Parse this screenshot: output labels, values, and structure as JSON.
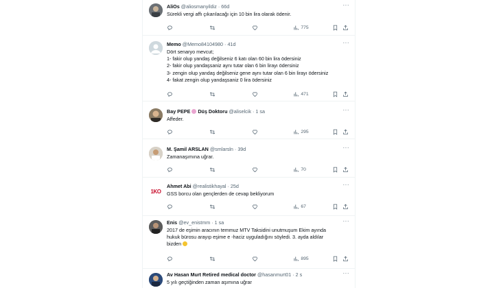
{
  "tweets": [
    {
      "name": "AliOs",
      "handle": "@aliosmanyildiz",
      "sep": "·",
      "time": "66d",
      "text": "Sürekli vergi affı çıkarılacağı için 10 bin lira olarak ödenir.",
      "views": "775",
      "replies": "",
      "retweets": "",
      "likes": ""
    },
    {
      "name": "Memo",
      "handle": "@Memo84104980",
      "sep": "·",
      "time": "41d",
      "text": "Dört senaryo mevcut;\n1- fakir olup yandaş değilseniz 6 katı olan 60 bin lira ödersiniz\n2- fakir olup yandaşsaniz aynı tutar olan 6 bin lirayı ödersiniz\n3- zengin olup yandaş değilseniz gene aynı tutar olan 6 bin lirayı ödersiniz\n4- fakat zengin olup  yandaşsaniz 0 lira ödersiniz",
      "views": "471",
      "replies": "",
      "retweets": "",
      "likes": ""
    },
    {
      "name": "Bay PEPE",
      "name2": "Düş Doktoru",
      "handle": "@aliselcik",
      "sep": "·",
      "time": "1 sa",
      "text": "Affeder.",
      "views": "295",
      "replies": "",
      "retweets": "",
      "likes": ""
    },
    {
      "name": "M. Şamil ARSLAN",
      "handle": "@smlarsln",
      "sep": "·",
      "time": "39d",
      "text": "Zamanaşımına uğrar.",
      "views": "70",
      "replies": "",
      "retweets": "",
      "likes": ""
    },
    {
      "name": "Ahmet Abi",
      "handle": "@realistikhayal",
      "sep": "·",
      "time": "25d",
      "text": "GSS borcu olan gençlerden de cevap bekliyorum",
      "views": "67",
      "replies": "",
      "retweets": "",
      "likes": ""
    },
    {
      "name": "Enis",
      "handle": "@ev_enistmm",
      "sep": "·",
      "time": "1 sa",
      "text": "2017 de eşimin aracının temmuz MTV Taksidini unutmuşum Ekim ayında\nhukuk bürosu arayıp eşime e -haciz uyguladığını söyledi. 3. ayda aldılar\nbizden",
      "views": "895",
      "replies": "",
      "retweets": "",
      "likes": ""
    },
    {
      "name": "Av Hasan Murt Retired medical doctor",
      "handle": "@hasanmurt01",
      "sep": "·",
      "time": "2 s",
      "text": "5 yılı geçtiğinden zaman aşımına uğrar",
      "views": "",
      "replies": "",
      "retweets": "",
      "likes": ""
    }
  ],
  "icons": {
    "more": "more-horizontal-icon",
    "reply": "reply-icon",
    "retweet": "retweet-icon",
    "like": "heart-icon",
    "views": "analytics-icon",
    "bookmark": "bookmark-icon",
    "share": "share-icon"
  },
  "avatar_letters": {
    "ahmet": "1KO"
  },
  "colors": {
    "text": "#0f1419",
    "meta": "#536471",
    "border": "#eff3f4"
  }
}
